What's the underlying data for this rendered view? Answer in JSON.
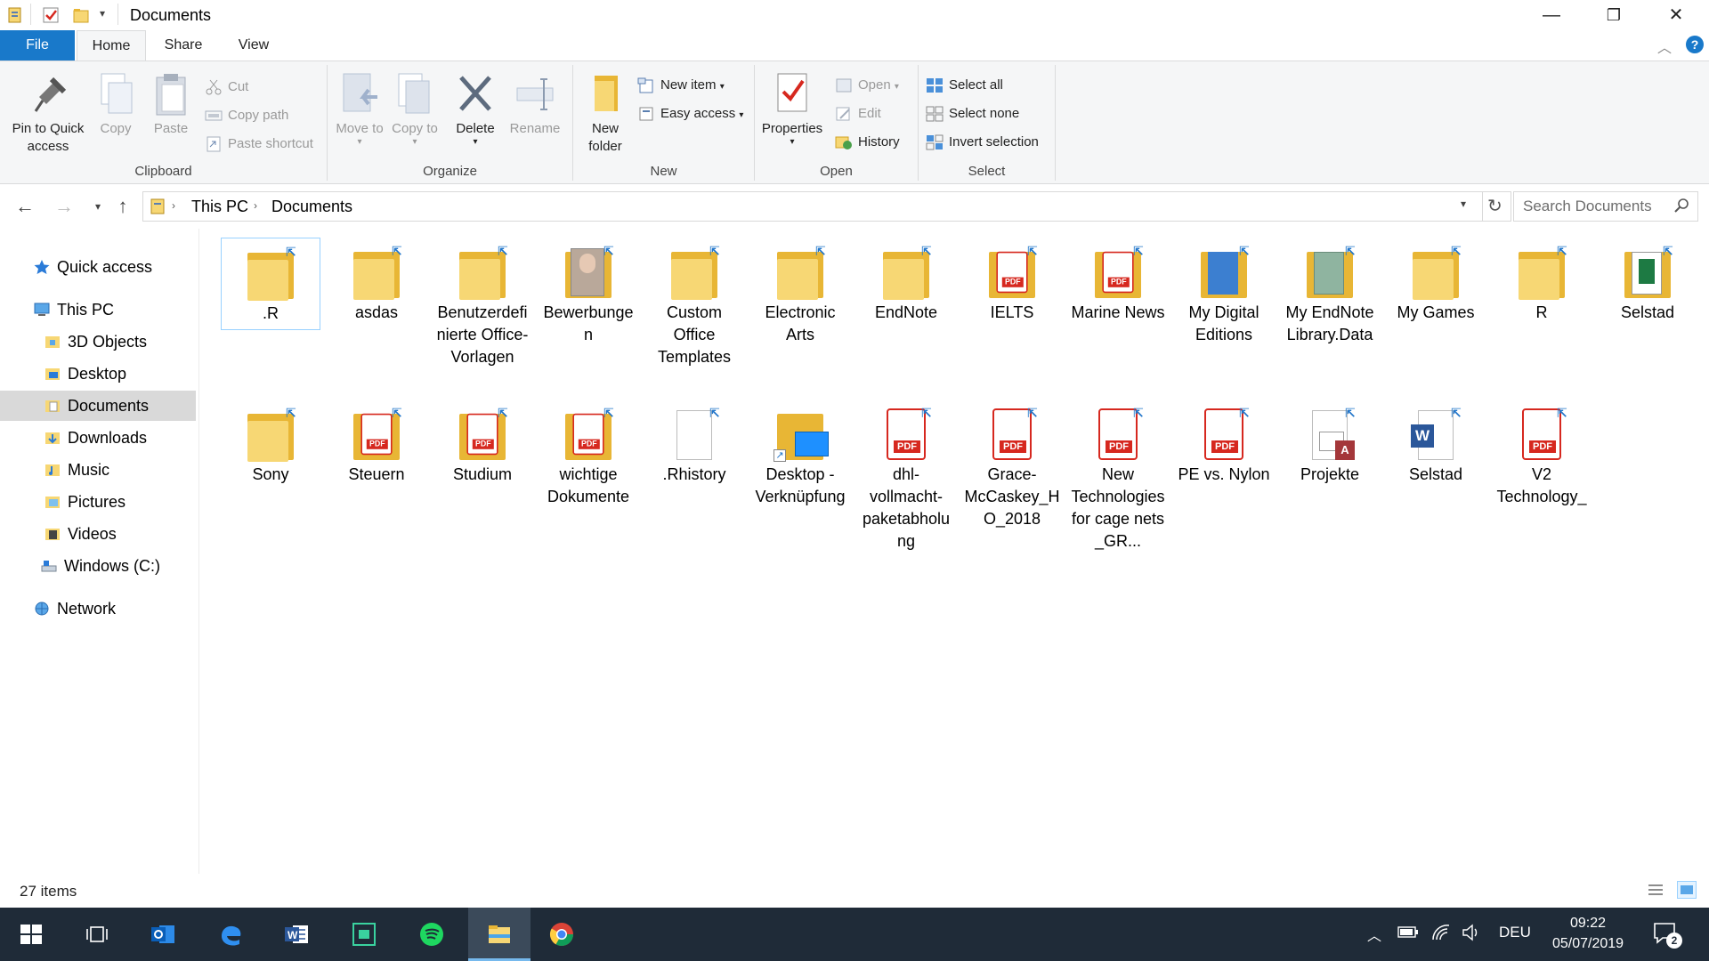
{
  "window": {
    "title": "Documents",
    "controls": {
      "minimize": "—",
      "restore": "❐",
      "close": "✕"
    }
  },
  "ribbon_tabs": [
    "File",
    "Home",
    "Share",
    "View"
  ],
  "ribbon": {
    "clipboard": {
      "label": "Clipboard",
      "pin_to_quick_access": "Pin to Quick access",
      "copy": "Copy",
      "paste": "Paste",
      "cut": "Cut",
      "copy_path": "Copy path",
      "paste_shortcut": "Paste shortcut"
    },
    "organize": {
      "label": "Organize",
      "move_to": "Move to",
      "copy_to": "Copy to",
      "delete": "Delete",
      "rename": "Rename"
    },
    "new": {
      "label": "New",
      "new_folder": "New folder",
      "new_item": "New item",
      "easy_access": "Easy access"
    },
    "open": {
      "label": "Open",
      "properties": "Properties",
      "open": "Open",
      "edit": "Edit",
      "history": "History"
    },
    "select": {
      "label": "Select",
      "select_all": "Select all",
      "select_none": "Select none",
      "invert_selection": "Invert selection"
    }
  },
  "address": {
    "crumbs": [
      "This PC",
      "Documents"
    ],
    "search_placeholder": "Search Documents"
  },
  "nav": {
    "quick_access": "Quick access",
    "this_pc": "This PC",
    "items": [
      "3D Objects",
      "Desktop",
      "Documents",
      "Downloads",
      "Music",
      "Pictures",
      "Videos",
      "Windows (C:)"
    ],
    "network": "Network"
  },
  "files": [
    {
      "name": ".R",
      "type": "folder"
    },
    {
      "name": "asdas",
      "type": "folder"
    },
    {
      "name": "Benutzerdefinierte Office-Vorlagen",
      "type": "folder"
    },
    {
      "name": "Bewerbungen",
      "type": "folder-photo"
    },
    {
      "name": "Custom Office Templates",
      "type": "folder"
    },
    {
      "name": "Electronic Arts",
      "type": "folder"
    },
    {
      "name": "EndNote",
      "type": "folder"
    },
    {
      "name": "IELTS",
      "type": "folder-pdf"
    },
    {
      "name": "Marine News",
      "type": "folder-pdf"
    },
    {
      "name": "My Digital Editions",
      "type": "folder-blue"
    },
    {
      "name": "My EndNote Library.Data",
      "type": "folder-map"
    },
    {
      "name": "My Games",
      "type": "folder"
    },
    {
      "name": "R",
      "type": "folder"
    },
    {
      "name": "Selstad",
      "type": "folder-excel"
    },
    {
      "name": "Sony",
      "type": "folder"
    },
    {
      "name": "Steuern",
      "type": "folder-pdf"
    },
    {
      "name": "Studium",
      "type": "folder-pdf"
    },
    {
      "name": "wichtige Dokumente",
      "type": "folder-pdf"
    },
    {
      "name": ".Rhistory",
      "type": "file"
    },
    {
      "name": "Desktop - Verknüpfung",
      "type": "shortcut"
    },
    {
      "name": "dhl-vollmacht-paketabholung",
      "type": "pdf"
    },
    {
      "name": "Grace-McCaskey_HO_2018",
      "type": "pdf"
    },
    {
      "name": "New Technologies for cage nets _GR...",
      "type": "pdf"
    },
    {
      "name": "PE vs. Nylon",
      "type": "pdf"
    },
    {
      "name": "Projekte",
      "type": "access"
    },
    {
      "name": "Selstad",
      "type": "word"
    },
    {
      "name": "V2 Technology_",
      "type": "pdf"
    }
  ],
  "status": {
    "count": "27 items"
  },
  "taskbar": {
    "language": "DEU",
    "time": "09:22",
    "date": "05/07/2019",
    "notifications": "2"
  },
  "colors": {
    "accent": "#1979ca",
    "folder": "#f7d774",
    "pdf_red": "#d6281f",
    "taskbar": "#1f2b38"
  }
}
